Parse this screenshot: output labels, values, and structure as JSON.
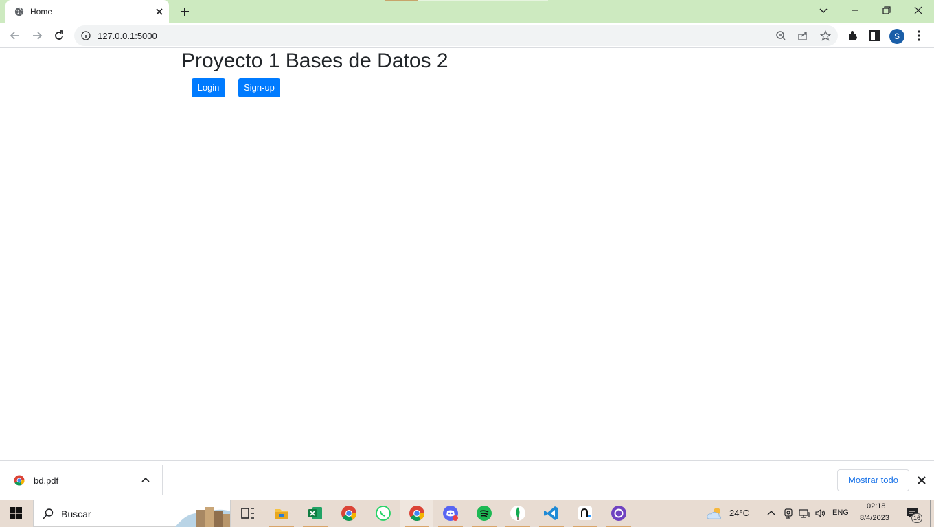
{
  "browser": {
    "tab_title": "Home",
    "url": "127.0.0.1:5000",
    "profile_initial": "S"
  },
  "page": {
    "title": "Proyecto 1 Bases de Datos 2",
    "buttons": {
      "login": "Login",
      "signup": "Sign-up"
    },
    "button_color": "#007bff"
  },
  "download_shelf": {
    "file_name": "bd.pdf",
    "show_all_label": "Mostrar todo"
  },
  "taskbar": {
    "search_placeholder": "Buscar",
    "apps": [
      "task-view",
      "file-explorer",
      "excel",
      "chrome",
      "whatsapp",
      "chrome",
      "discord",
      "spotify",
      "mongodb-compass",
      "vscode",
      "postman",
      "github-desktop"
    ],
    "weather_temp": "24°C",
    "language": "ENG",
    "clock_time": "02:18",
    "clock_date": "8/4/2023",
    "notification_count": "16"
  },
  "colors": {
    "tabstrip": "#cdeac0",
    "taskbar": "#e8dcd2",
    "link_blue": "#1a73e8"
  }
}
